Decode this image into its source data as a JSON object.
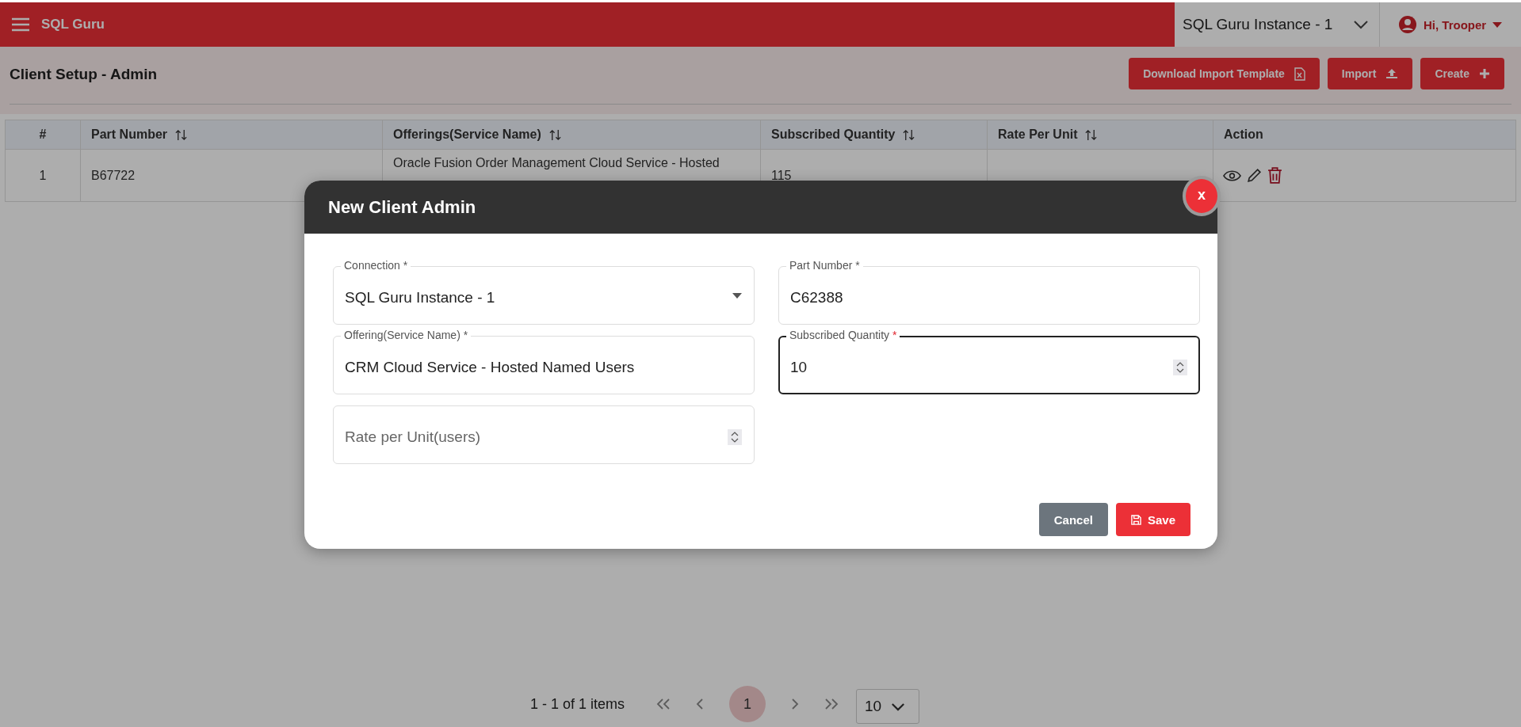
{
  "topbar": {
    "app_name": "SQL Guru",
    "instance_select": {
      "value": "SQL Guru Instance - 1"
    },
    "user": {
      "label": "Hi, Trooper"
    }
  },
  "page": {
    "title": "Client Setup - Admin",
    "buttons": [
      {
        "label": "Download Import Template",
        "kind": "download"
      },
      {
        "label": "Import",
        "kind": "import"
      },
      {
        "label": "Create",
        "kind": "create"
      }
    ]
  },
  "table": {
    "columns": [
      {
        "label": "#",
        "sortable": false
      },
      {
        "label": "Part Number",
        "sortable": true
      },
      {
        "label": "Offerings(Service Name)",
        "sortable": true
      },
      {
        "label": "Subscribed Quantity",
        "sortable": true
      },
      {
        "label": "Rate Per Unit",
        "sortable": true
      },
      {
        "label": "Action",
        "sortable": false
      }
    ],
    "rows": [
      {
        "cells": [
          "1",
          "B67722",
          "Oracle Fusion Order Management Cloud Service - Hosted",
          "115",
          null
        ]
      }
    ]
  },
  "pagination": {
    "summary": "1 - 1 of 1 items",
    "pages": [
      {
        "label": "1",
        "selected": true
      }
    ],
    "page_size": "10"
  },
  "modal": {
    "title": "New Client Admin",
    "close": "x",
    "fields": [
      {
        "kind": "select",
        "label": "Connection",
        "required_mark": "*",
        "value": "SQL Guru Instance - 1",
        "focused": false
      },
      {
        "kind": "text",
        "label": "Part Number",
        "required_mark": "*",
        "value": "C62388",
        "focused": false
      },
      {
        "kind": "text",
        "label": "Offering(Service Name)",
        "required_mark": "*",
        "value": "CRM Cloud Service - Hosted Named Users",
        "focused": false
      },
      {
        "kind": "number",
        "label": "Subscribed Quantity",
        "required_mark": "*",
        "value": "10",
        "focused": true
      },
      {
        "kind": "number",
        "placeholder": "Rate per Unit(users)",
        "focused": false
      }
    ],
    "buttons": [
      {
        "label": "Cancel",
        "kind": "cancel"
      },
      {
        "label": "Save",
        "kind": "save"
      }
    ]
  }
}
